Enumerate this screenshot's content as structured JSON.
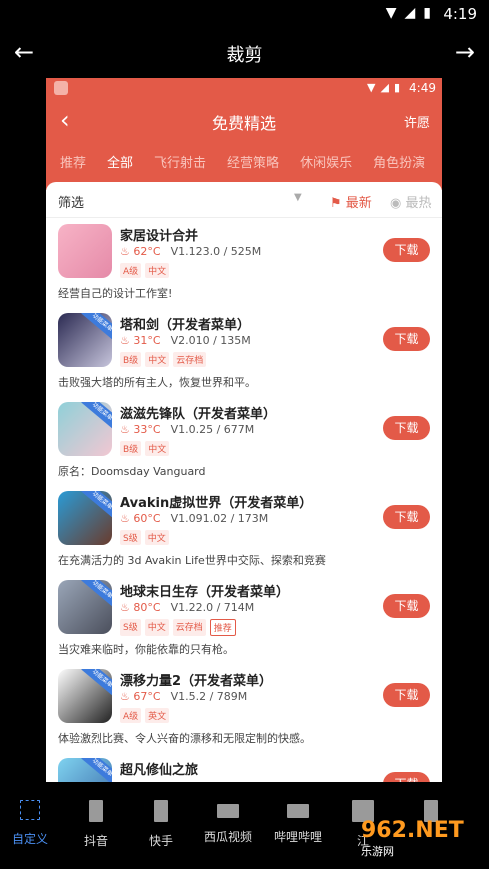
{
  "status": {
    "time": "4:19"
  },
  "crop": {
    "title": "裁剪"
  },
  "preview": {
    "time": "4:49",
    "title": "免费精选",
    "wish": "许愿",
    "tabs": [
      "推荐",
      "全部",
      "飞行射击",
      "经营策略",
      "休闲娱乐",
      "角色扮演"
    ],
    "filter": {
      "label": "筛选",
      "newest": "最新",
      "hottest": "最热"
    },
    "apps": [
      {
        "name": "家居设计合并",
        "temp": "62°C",
        "ver": "V1.123.0 / 525M",
        "badges": [
          "A级",
          "中文"
        ],
        "desc": "经营自己的设计工作室!",
        "tag": "",
        "color1": "#f7b3c6",
        "color2": "#e58aa8",
        "download": "下载"
      },
      {
        "name": "塔和剑（开发者菜单）",
        "temp": "31°C",
        "ver": "V2.010 / 135M",
        "badges": [
          "B级",
          "中文",
          "云存档"
        ],
        "desc": "击败强大塔的所有主人，恢复世界和平。",
        "tag": "功能菜单",
        "color1": "#2b2a52",
        "color2": "#c7c5dc",
        "download": "下载"
      },
      {
        "name": "滋滋先锋队（开发者菜单）",
        "temp": "33°C",
        "ver": "V1.0.25 / 677M",
        "badges": [
          "B级",
          "中文"
        ],
        "desc": "原名：Doomsday Vanguard",
        "tag": "功能菜单",
        "color1": "#8fd0d8",
        "color2": "#f2c7d2",
        "download": "下载"
      },
      {
        "name": "Avakin虚拟世界（开发者菜单）",
        "temp": "60°C",
        "ver": "V1.091.02 / 173M",
        "badges": [
          "S级",
          "中文"
        ],
        "desc": "在充满活力的 3d Avakin Life世界中交际、探索和竞赛",
        "tag": "功能菜单",
        "color1": "#2a9bd6",
        "color2": "#6a3b2c",
        "download": "下载"
      },
      {
        "name": "地球末日生存（开发者菜单）",
        "temp": "80°C",
        "ver": "V1.22.0 / 714M",
        "badges": [
          "S级",
          "中文",
          "云存档",
          "推荐"
        ],
        "desc": "当灾难来临时，你能依靠的只有枪。",
        "tag": "功能菜单",
        "color1": "#9aa6b8",
        "color2": "#4b4f5c",
        "download": "下载"
      },
      {
        "name": "漂移力量2（开发者菜单）",
        "temp": "67°C",
        "ver": "V1.5.2 / 789M",
        "badges": [
          "A级",
          "英文"
        ],
        "desc": "体验激烈比赛、令人兴奋的漂移和无限定制的快感。",
        "tag": "功能菜单",
        "color1": "#ffffff",
        "color2": "#222222",
        "download": "下载"
      },
      {
        "name": "超凡修仙之旅",
        "temp": "",
        "ver": "",
        "badges": [],
        "desc": "",
        "tag": "功能菜单",
        "color1": "#7fd3f0",
        "color2": "#3c6aa8",
        "download": "下载"
      }
    ]
  },
  "bottom": {
    "items": [
      {
        "label": "自定义",
        "active": true
      },
      {
        "label": "抖音"
      },
      {
        "label": "快手"
      },
      {
        "label": "西瓜视频"
      },
      {
        "label": "哔哩哔哩"
      },
      {
        "label": "江"
      },
      {
        "label": ""
      }
    ]
  },
  "watermark": {
    "line1": "962.NET",
    "line2": "乐游网"
  }
}
